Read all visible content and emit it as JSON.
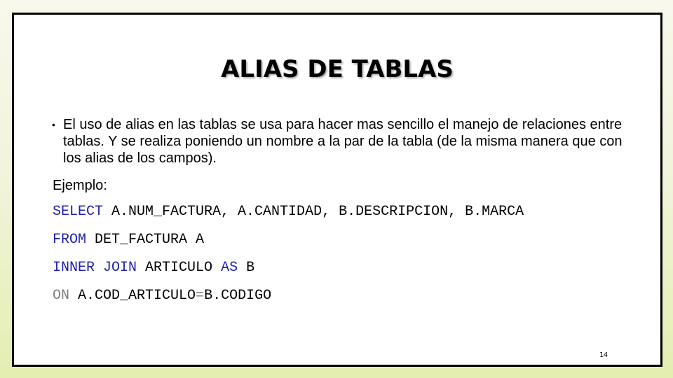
{
  "slide": {
    "title": "ALIAS DE TABLAS",
    "bullet": {
      "icon": "bullet-dot",
      "glyph": "•",
      "text": "El uso de alias en las tablas se usa para hacer mas sencillo el manejo de relaciones entre tablas. Y se realiza poniendo un nombre a la par de la tabla (de la misma manera que con los alias de los campos)."
    },
    "example_label": "Ejemplo:",
    "code": {
      "line1": {
        "kw1": "SELECT",
        "rest": " A.NUM_FACTURA, A.CANTIDAD, B.DESCRIPCION, B.MARCA"
      },
      "line2": {
        "kw1": "FROM",
        "rest": " DET_FACTURA A"
      },
      "line3": {
        "kw1": "INNER JOIN",
        "mid": " ARTICULO ",
        "kw2": "AS",
        "rest": " B"
      },
      "line4": {
        "kw1": "ON",
        "left": " A.COD_ARTICULO",
        "op": "=",
        "right": "B.CODIGO"
      }
    },
    "page_number": "14",
    "colors": {
      "keyword": "#1f1fa8",
      "secondary_keyword": "#808080",
      "text": "#000000",
      "frame": "#000000"
    }
  }
}
